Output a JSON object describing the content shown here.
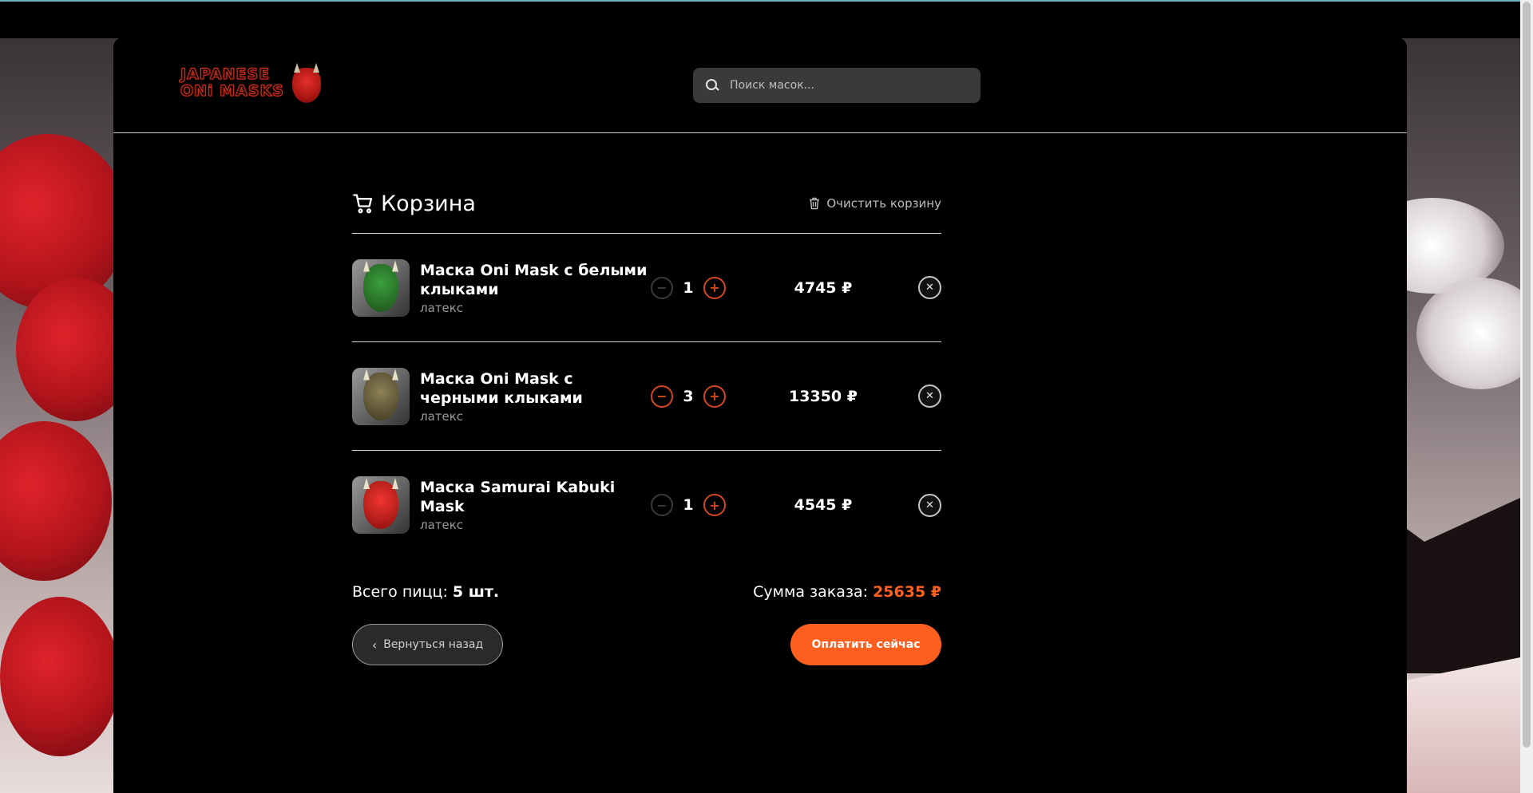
{
  "header": {
    "logo_line1": "JAPANESE",
    "logo_line2": "ONi MASKS",
    "search_placeholder": "Поиск масок..."
  },
  "cart": {
    "title": "Корзина",
    "clear_label": "Очистить корзину",
    "items": [
      {
        "name": "Маска Oni Mask с белыми клыками",
        "material": "латекс",
        "qty": "1",
        "price": "4745 ₽",
        "mask_color": "#2f7a2f"
      },
      {
        "name": "Маска Oni Mask с черными клыками",
        "material": "латекс",
        "qty": "3",
        "price": "13350 ₽",
        "mask_color": "#6b5f3a"
      },
      {
        "name": "Маска Samurai Kabuki Mask",
        "material": "латекс",
        "qty": "1",
        "price": "4545 ₽",
        "mask_color": "#d0201e"
      }
    ],
    "minus_symbol": "−",
    "plus_symbol": "+",
    "remove_symbol": "✕",
    "total_count_label": "Всего пицц:",
    "total_count_value": "5 шт.",
    "total_sum_label": "Сумма заказа:",
    "total_sum_value": "25635 ₽",
    "back_label": "Вернуться назад",
    "pay_label": "Оплатить сейчас"
  },
  "colors": {
    "accent": "#fe5f1e",
    "background": "#000000"
  }
}
